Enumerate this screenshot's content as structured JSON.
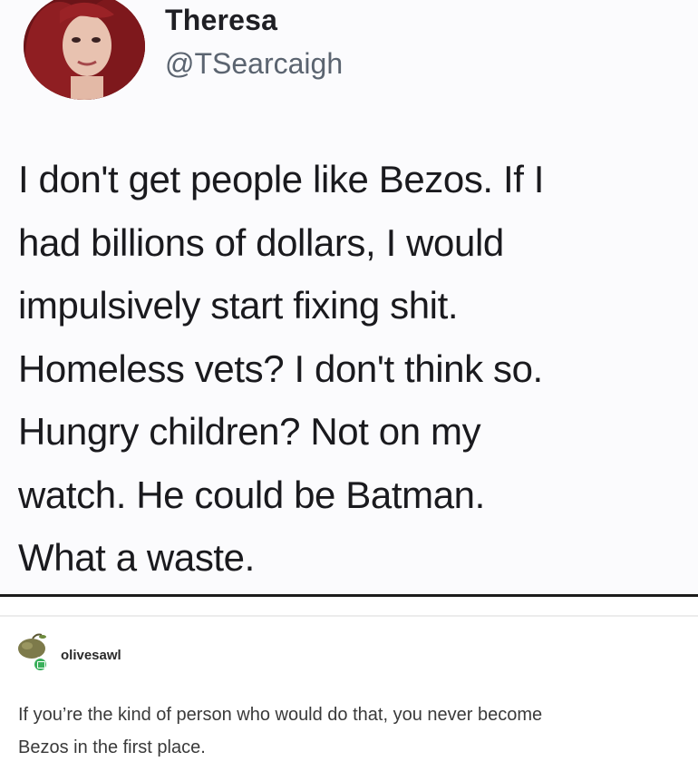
{
  "tweet": {
    "display_name": "Theresa",
    "handle": "@TSearcaigh",
    "text_lines": [
      "I don't get people like Bezos. If I",
      "had billions of dollars, I would",
      "impulsively start fixing shit.",
      "Homeless vets? I don't think so.",
      "Hungry children? Not on my",
      "watch. He could be Batman.",
      "What a waste."
    ]
  },
  "reblog": {
    "username": "olivesawl",
    "text_lines": [
      "If you’re the kind of person who would do that, you never become",
      "Bezos in the first place."
    ]
  },
  "icons": {
    "tweet_avatar": "profile-photo",
    "reblog_avatar": "olive-avatar",
    "reblog_badge": "chat-badge-icon"
  },
  "colors": {
    "tweet_text": "#1a1a1e",
    "handle": "#5b6470",
    "badge": "#3ab05b",
    "divider": "#1b1b1b"
  }
}
